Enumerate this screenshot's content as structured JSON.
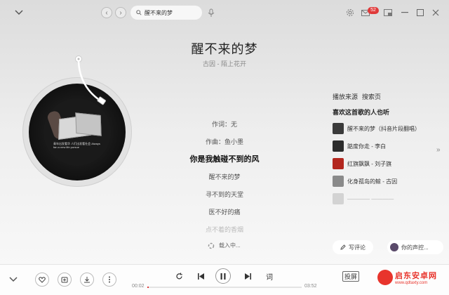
{
  "header": {
    "search_value": "醒不来的梦",
    "mail_badge": "52"
  },
  "song": {
    "title": "醒不来的梦",
    "subtitle": "古因 - 陌上花开"
  },
  "cover": {
    "caption": "青年出发看华 人们出发看社会 Always fan a new life pursue"
  },
  "lyrics": [
    {
      "text": "作词：无",
      "state": "normal"
    },
    {
      "text": "作曲：鱼小墨",
      "state": "normal"
    },
    {
      "text": "你是我触碰不到的风",
      "state": "active"
    },
    {
      "text": "醒不来的梦",
      "state": "normal"
    },
    {
      "text": "寻不到的天堂",
      "state": "normal"
    },
    {
      "text": "医不好的痛",
      "state": "normal"
    },
    {
      "text": "点不着的香烟",
      "state": "fade"
    }
  ],
  "loading_text": "载入中...",
  "side": {
    "source_label": "播放来源",
    "source_value": "搜索页",
    "title": "喜欢这首歌的人也听",
    "similar": [
      {
        "title": "醒不来的梦（抖音片段翻唱）",
        "color": "#3a3a3a"
      },
      {
        "title": "踮度你走 - 李白",
        "color": "#2c2c2c"
      },
      {
        "title": "红旗飘飘 - 刘子旗",
        "color": "#b3261e"
      },
      {
        "title": "化身孤岛的鲸 - 古因",
        "color": "#8a8a8a"
      },
      {
        "title": "———— ————",
        "color": "#9a9a9a"
      }
    ],
    "comment_label": "写评论",
    "voice_label": "你的声控..."
  },
  "player": {
    "time_current": "00:02",
    "time_total": "03:52",
    "progress": 0.01,
    "lyric_label": "词",
    "cast_label": "投屏"
  },
  "watermark": {
    "name": "启东安卓网",
    "url": "www.qdtaxty.com"
  },
  "colors": {
    "accent": "#e03a3a",
    "watermark": "#e8342c"
  }
}
